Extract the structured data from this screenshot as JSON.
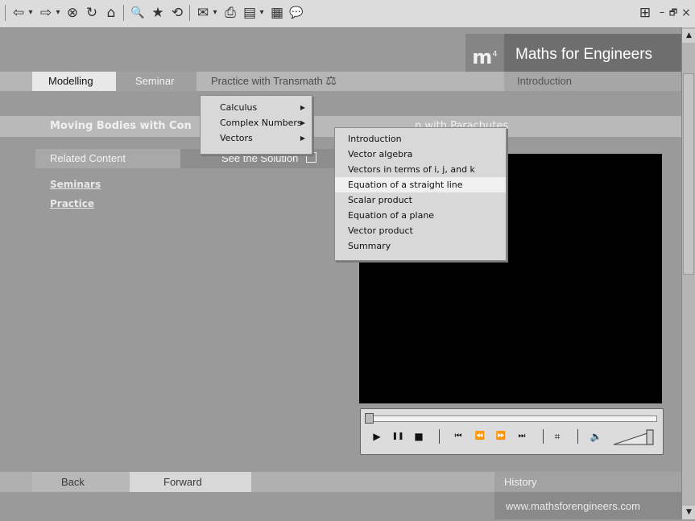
{
  "browser_toolbar": {
    "icons": [
      "back-arrow-icon",
      "dropdown-icon",
      "forward-arrow-icon",
      "dropdown-icon",
      "stop-icon",
      "refresh-icon",
      "home-icon",
      "search-icon",
      "favorites-icon",
      "history-icon",
      "mail-icon",
      "print-icon",
      "edit-icon",
      "discuss-icon",
      "messenger-icon"
    ],
    "glyphs": {
      "back": "⇦",
      "drop": "▾",
      "forward": "⇨",
      "stop": "⊗",
      "refresh": "↻",
      "home": "⌂",
      "search": "🔍",
      "favorites": "★",
      "history": "⟲",
      "mail": "✉",
      "print": "⎙",
      "edit": "▤",
      "discuss": "▦",
      "messenger": "💬",
      "windows": "⊞"
    },
    "window_controls": {
      "minimize": "–",
      "restore": "🗗",
      "close": "×"
    }
  },
  "header": {
    "logo_text": "m",
    "logo_superscript": "4",
    "brand": "Maths for Engineers"
  },
  "nav": {
    "modelling": "Modelling",
    "seminar": "Seminar",
    "practice": "Practice with Transmath",
    "practice_icon": "⚖",
    "introduction": "Introduction"
  },
  "lesson": {
    "title": "Moving Bodies with Con",
    "title_tail": "n with Parachutes"
  },
  "sidebar": {
    "related_content": "Related Content",
    "links": [
      "Seminars",
      "Practice"
    ]
  },
  "see_solution": "See the Solution",
  "menu_level1": [
    {
      "label": "Calculus"
    },
    {
      "label": "Complex Numbers"
    },
    {
      "label": "Vectors"
    }
  ],
  "menu_level2": [
    {
      "label": "Introduction",
      "highlighted": false
    },
    {
      "label": "Vector algebra",
      "highlighted": false
    },
    {
      "label": "Vectors in terms of i, j, and k",
      "highlighted": false
    },
    {
      "label": "Equation of a straight line",
      "highlighted": true
    },
    {
      "label": "Scalar product",
      "highlighted": false
    },
    {
      "label": "Equation of a plane",
      "highlighted": false
    },
    {
      "label": "Vector product",
      "highlighted": false
    },
    {
      "label": "Summary",
      "highlighted": false
    }
  ],
  "player": {
    "play": "▶",
    "pause": "❚❚",
    "stop": "■",
    "start": "⏮",
    "rewind": "⏪",
    "fast_forward": "⏩",
    "end": "⏭",
    "chapters": "⌗",
    "volume": "🔈"
  },
  "footer": {
    "back": "Back",
    "forward": "Forward",
    "history": "History",
    "site": "www.mathsforengineers.com"
  },
  "colors": {
    "video_bg": "#000000",
    "brand_bg": "#6e6e6e",
    "highlight": "#f0f0f0"
  }
}
